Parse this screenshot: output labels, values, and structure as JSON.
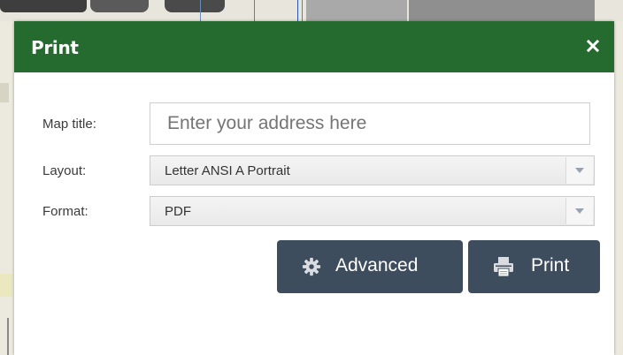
{
  "dialog": {
    "title": "Print",
    "close_icon": "close-icon",
    "header_color": "#256b2f"
  },
  "form": {
    "map_title": {
      "label": "Map title:",
      "placeholder": "Enter your address here",
      "value": ""
    },
    "layout": {
      "label": "Layout:",
      "selected": "Letter ANSI A Portrait"
    },
    "format": {
      "label": "Format:",
      "selected": "PDF"
    }
  },
  "buttons": {
    "advanced": {
      "label": "Advanced",
      "icon": "gear-icon"
    },
    "print": {
      "label": "Print",
      "icon": "printer-icon"
    },
    "color": "#3e4d5e"
  }
}
